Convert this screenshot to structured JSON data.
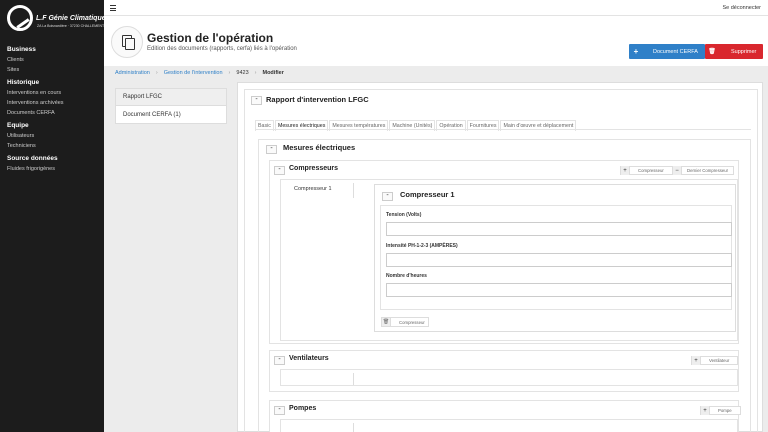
{
  "sidebar": {
    "logo_title": "L.F Génie Climatique",
    "logo_sub": "ZA La Boisnardière · 37230 CHALLEMENT",
    "sections": [
      {
        "title": "Business",
        "items": [
          "Clients",
          "Sites"
        ]
      },
      {
        "title": "Historique",
        "items": [
          "Interventions en cours",
          "Interventions archivées",
          "Documents CERFA"
        ]
      },
      {
        "title": "Equipe",
        "items": [
          "Utilisateurs",
          "Techniciens"
        ]
      },
      {
        "title": "Source données",
        "items": [
          "Fluides frigorigènes"
        ]
      }
    ]
  },
  "topbar": {
    "logout": "Se déconnecter"
  },
  "header": {
    "title": "Gestion de l'opération",
    "subtitle": "Edition des documents (rapports, cerfa) liés à l'opération",
    "btn_cerfa": "Document CERFA",
    "btn_delete": "Supprimer"
  },
  "breadcrumb": [
    "Administration",
    "Gestion de l'intervention",
    "9423",
    "Modifier"
  ],
  "doclist": [
    "Rapport LFGC",
    "Document CERFA (1)"
  ],
  "report": {
    "title": "Rapport d'intervention LFGC",
    "tabs": [
      "Basic",
      "Mesures électriques",
      "Mesures températures",
      "Machine (Unités)",
      "Opération",
      "Fournitures",
      "Main d'œuvre et déplacement"
    ],
    "active_tab": "Mesures électriques"
  },
  "mesures": {
    "title": "Mesures électriques",
    "compresseurs": {
      "title": "Compresseurs",
      "add_btn": "Compresseur",
      "remove_btn": "Dernier Compresseur",
      "list_item": "Compresseur 1",
      "item_title": "Compresseur 1",
      "fields": [
        {
          "label": "Tension (Volts)",
          "value": ""
        },
        {
          "label": "Intensité PH-1-2-3 (AMPÈRES)",
          "value": ""
        },
        {
          "label": "Nombre d'heures",
          "value": ""
        }
      ],
      "delete_btn": "Compresseur"
    },
    "ventilateurs": {
      "title": "Ventilateurs",
      "add_btn": "Ventilateur"
    },
    "pompes": {
      "title": "Pompes",
      "add_btn": "Pompe"
    }
  },
  "colors": {
    "primary": "#2f80c8",
    "danger": "#d9272e",
    "sidebar": "#1c1c1c"
  }
}
